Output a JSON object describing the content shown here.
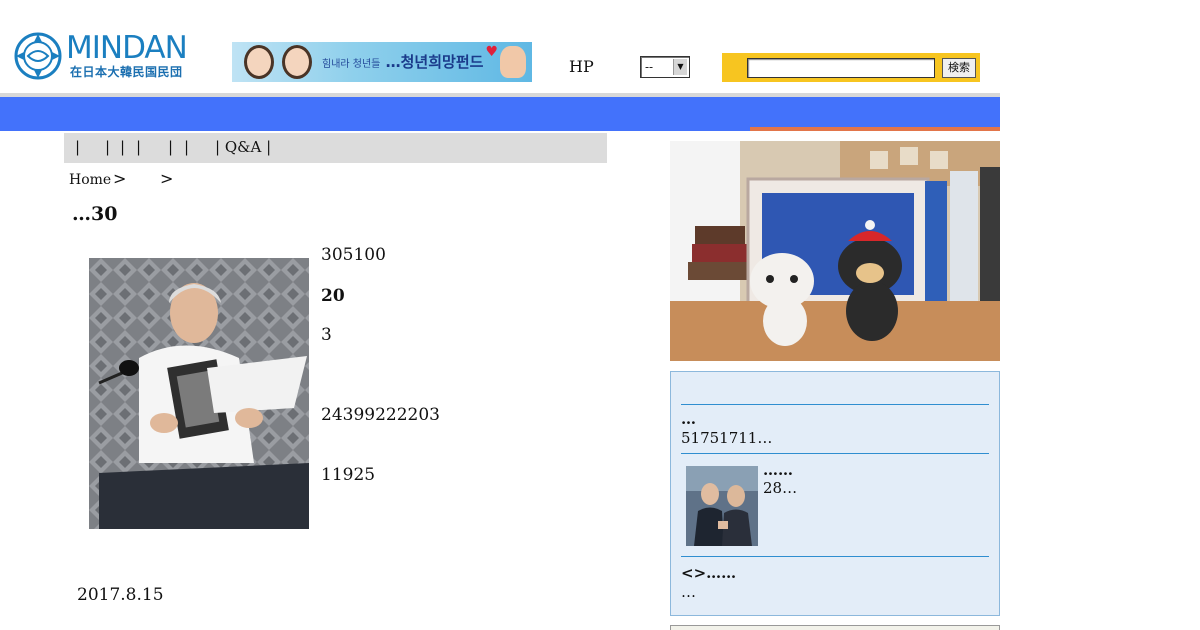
{
  "header": {
    "logo_text": "MINDAN",
    "logo_subtitle": "在日本大韓民国民団",
    "banner_small": "힘내라 청년들",
    "banner_main": "…청년희망펀드",
    "hp_label": "HP",
    "hp_select_value": "--",
    "search_value": "",
    "search_button": "検索"
  },
  "nav": {
    "submenu_items": [
      "|",
      "|",
      "|",
      "|",
      "|",
      "|",
      "| Q&A |"
    ]
  },
  "breadcrumb": {
    "home": "Home",
    "sep1": ">",
    "sep2": ">"
  },
  "article": {
    "title": "…30",
    "lines": [
      {
        "text": "305100",
        "bold": false
      },
      {
        "text": "20",
        "bold": true
      },
      {
        "text": "3",
        "bold": false
      },
      {
        "text": "24399222203",
        "bold": false
      },
      {
        "text": "11925",
        "bold": false
      }
    ],
    "date": "2017.8.15"
  },
  "sidebar": {
    "news": [
      {
        "title": "…",
        "body": "51751711…"
      },
      {
        "title": "……",
        "body": "28…"
      },
      {
        "title": "<>……",
        "body": "…"
      }
    ]
  },
  "colors": {
    "nav_blue": "#4372fb",
    "nav_orange": "#e2754a",
    "search_yellow": "#f7c520",
    "panel_bg": "#e3edf8"
  }
}
